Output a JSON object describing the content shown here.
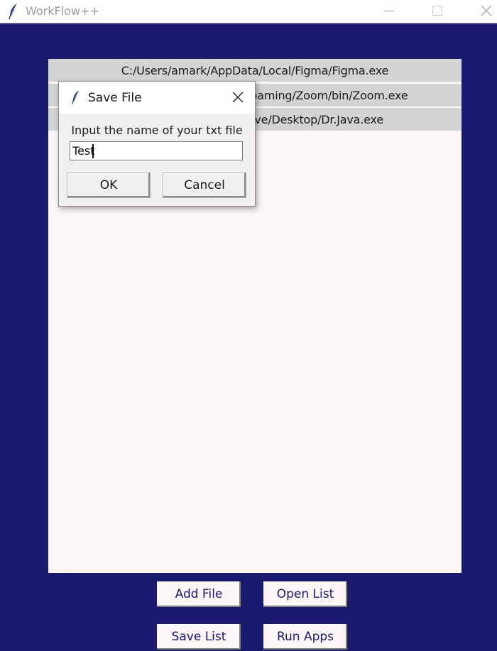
{
  "window": {
    "title": "WorkFlow++",
    "icon": "feather-icon"
  },
  "file_list": {
    "rows": [
      "C:/Users/amark/AppData/Local/Figma/Figma.exe",
      "C:/Users/amark/AppData/Roaming/Zoom/bin/Zoom.exe",
      "C:/Users/amark/OneDrive/Desktop/Dr.Java.exe"
    ]
  },
  "buttons": {
    "add_file": "Add File",
    "open_list": "Open List",
    "save_list": "Save List",
    "run_apps": "Run Apps"
  },
  "dialog": {
    "title": "Save File",
    "icon": "feather-icon",
    "prompt": "Input the name of your txt file",
    "input_value": "Test",
    "ok_label": "OK",
    "cancel_label": "Cancel"
  },
  "colors": {
    "background": "#1a1a6e",
    "list_background": "#fcf6f6",
    "row_highlight": "#d4d4d4",
    "button_text": "#1a1a6e"
  }
}
